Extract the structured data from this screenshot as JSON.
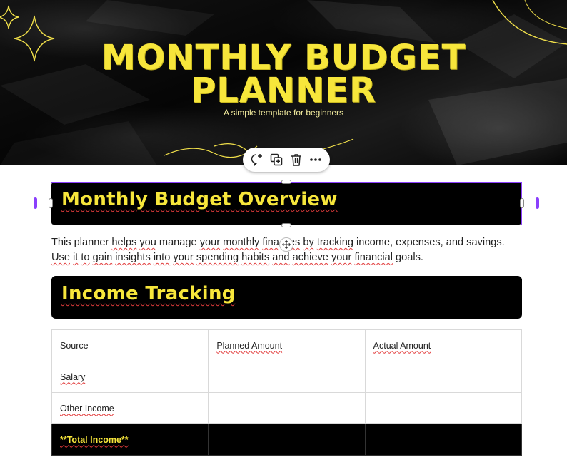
{
  "hero": {
    "title_line1": "MONTHLY BUDGET",
    "title_line2": "PLANNER",
    "subtitle": "A simple template for beginners"
  },
  "toolbar": {
    "items": [
      {
        "icon": "comment-add-icon"
      },
      {
        "icon": "duplicate-icon"
      },
      {
        "icon": "trash-icon"
      },
      {
        "icon": "more-icon"
      }
    ]
  },
  "overview": {
    "heading": "Monthly Budget Overview",
    "paragraph_parts": [
      "This planner ",
      "helps",
      " ",
      "you",
      " manage ",
      "your",
      " ",
      "monthly",
      " ",
      "fina",
      "",
      "es",
      " ",
      "by",
      " ",
      "tracking",
      " income, expenses, and savings.",
      "Use",
      " ",
      "it",
      " ",
      "to",
      " ",
      "gain",
      " ",
      "insights",
      " ",
      "into",
      " ",
      "your",
      " ",
      "spending",
      " ",
      "habits",
      " ",
      "and",
      " ",
      "achieve",
      " ",
      "your",
      " ",
      "financial",
      " goals."
    ]
  },
  "income": {
    "heading": "Income Tracking",
    "columns": [
      "Source",
      "Planned Amount",
      "Actual Amount"
    ],
    "rows": [
      [
        "Salary",
        "",
        ""
      ],
      [
        "Other Income",
        "",
        ""
      ]
    ],
    "total_label": "**Total Income**"
  },
  "colors": {
    "accent_yellow": "#f7e63b",
    "selection_purple": "#8a3ffc",
    "spellcheck_red": "#e23b3b"
  }
}
